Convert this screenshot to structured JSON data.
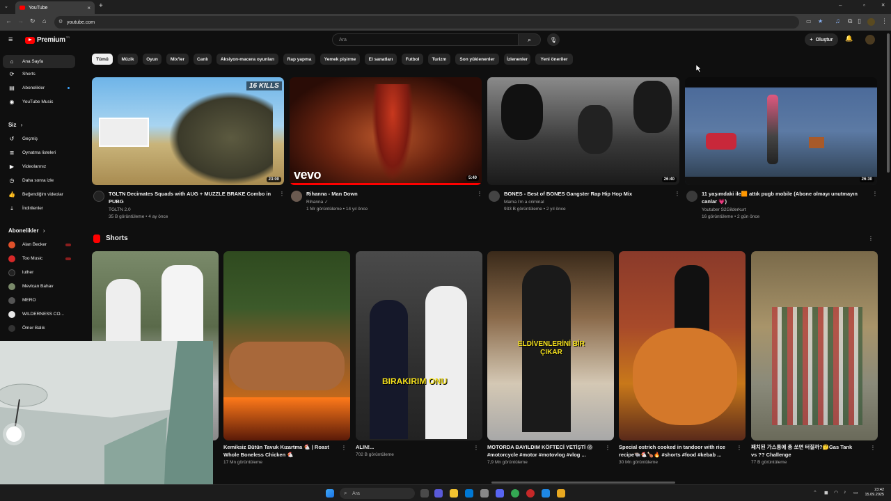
{
  "browser": {
    "tab_title": "YouTube",
    "url": "youtube.com"
  },
  "header": {
    "logo_text": "Premium",
    "logo_sup": "TR",
    "search_placeholder": "Ara",
    "create_label": "Oluştur"
  },
  "sidebar": {
    "main": [
      {
        "label": "Ana Sayfa",
        "icon": "home-icon"
      },
      {
        "label": "Shorts",
        "icon": "shorts-icon"
      },
      {
        "label": "Abonelikler",
        "icon": "subscriptions-icon"
      },
      {
        "label": "YouTube Music",
        "icon": "music-icon"
      }
    ],
    "you_heading": "Siz",
    "you": [
      {
        "label": "Geçmiş",
        "icon": "history-icon"
      },
      {
        "label": "Oynatma listeleri",
        "icon": "playlist-icon"
      },
      {
        "label": "Videolarınız",
        "icon": "your-videos-icon"
      },
      {
        "label": "Daha sonra izle",
        "icon": "watch-later-icon"
      },
      {
        "label": "Beğendiğim videolar",
        "icon": "like-icon"
      },
      {
        "label": "İndirilenler",
        "icon": "download-icon"
      }
    ],
    "subs_heading": "Abonelikler",
    "subs": [
      {
        "label": "Alan Becker",
        "color": "#e0502a"
      },
      {
        "label": "Too Music",
        "color": "#d62828"
      },
      {
        "label": "luther",
        "color": "#222222"
      },
      {
        "label": "Mevlcan Bahav",
        "color": "#7a8a6a"
      },
      {
        "label": "MERO",
        "color": "#555555"
      },
      {
        "label": "WILDERNESS CO...",
        "color": "#e8e8e8"
      },
      {
        "label": "Ömer Balık",
        "color": "#333333"
      }
    ]
  },
  "chips": [
    "Tümü",
    "Müzik",
    "Oyun",
    "Mix'ler",
    "Canlı",
    "Aksiyon-macera oyunları",
    "Rap yapma",
    "Yemek pişirme",
    "El sanatları",
    "Futbol",
    "Turizm",
    "Son yüklenenler",
    "İzlenenler",
    "Yeni öneriler"
  ],
  "videos": [
    {
      "title_line1": "TGLTN Decimates Squads with AUG + MUZZLE BRAKE Combo in",
      "title_line2": "PUBG",
      "channel": "TGLTN 2.0",
      "meta": "35 B görüntüleme • 4 ay önce",
      "duration": "23:00",
      "badge": "16 KILLS"
    },
    {
      "title_line1": "Rihanna - Man Down",
      "title_line2": "",
      "channel": "Rihanna",
      "meta": "1 Mr görüntüleme • 14 yıl önce",
      "duration": "5:40",
      "badge": "vevo"
    },
    {
      "title_line1": "BONES - Best of BONES Gangster Rap Hip Hop Mix",
      "title_line2": "",
      "channel": "Mama i'm a criminal",
      "meta": "933 B görüntüleme • 2 yıl önce",
      "duration": "26:40",
      "badge": ""
    },
    {
      "title_line1": "11 yaşımdaki ile🟧 attık pugb mobile (Abone olmayı unutmayın",
      "title_line2": "canlar 💗)",
      "channel": "Youtuber S2Gilderkurt",
      "meta": "16 görüntüleme • 2 gün önce",
      "duration": "26:30",
      "badge": ""
    }
  ],
  "shorts_heading": "Shorts",
  "shorts": [
    {
      "title_line1": "",
      "title_line2": "",
      "views": "",
      "overlay": ""
    },
    {
      "title_line1": "Kemiksiz Bütün Tavuk Kızartma 🐔 | Roast",
      "title_line2": "Whole Boneless Chicken 🐔",
      "views": "17 Mn görüntüleme",
      "overlay": ""
    },
    {
      "title_line1": "ALIN!...",
      "title_line2": "",
      "views": "702 B görüntüleme",
      "overlay": "BIRAKIRIM ONU"
    },
    {
      "title_line1": "MOTORDA BAYILDIM KÖFTECİ YETİŞTİ 😱",
      "title_line2": "#motorcycle #motor #motovlog #vlog ...",
      "views": "7,9 Mn görüntüleme",
      "overlay": "ELDİVENLERİNİ BİR ÇIKAR"
    },
    {
      "title_line1": "Special ostrich cooked in tandoor with rice",
      "title_line2": "recipe🐃🐔🍗🔥 #shorts #food #kebab ...",
      "views": "30 Mn görüntüleme",
      "overlay": ""
    },
    {
      "title_line1": "패치된 가스통에 총 쏘면 터질까?🤔Gas Tank",
      "title_line2": "vs ?? Challenge",
      "views": "77 B görüntüleme",
      "overlay": ""
    }
  ],
  "taskbar": {
    "search_placeholder": "Ara",
    "time": "23:42",
    "date": "15.09.2025"
  }
}
